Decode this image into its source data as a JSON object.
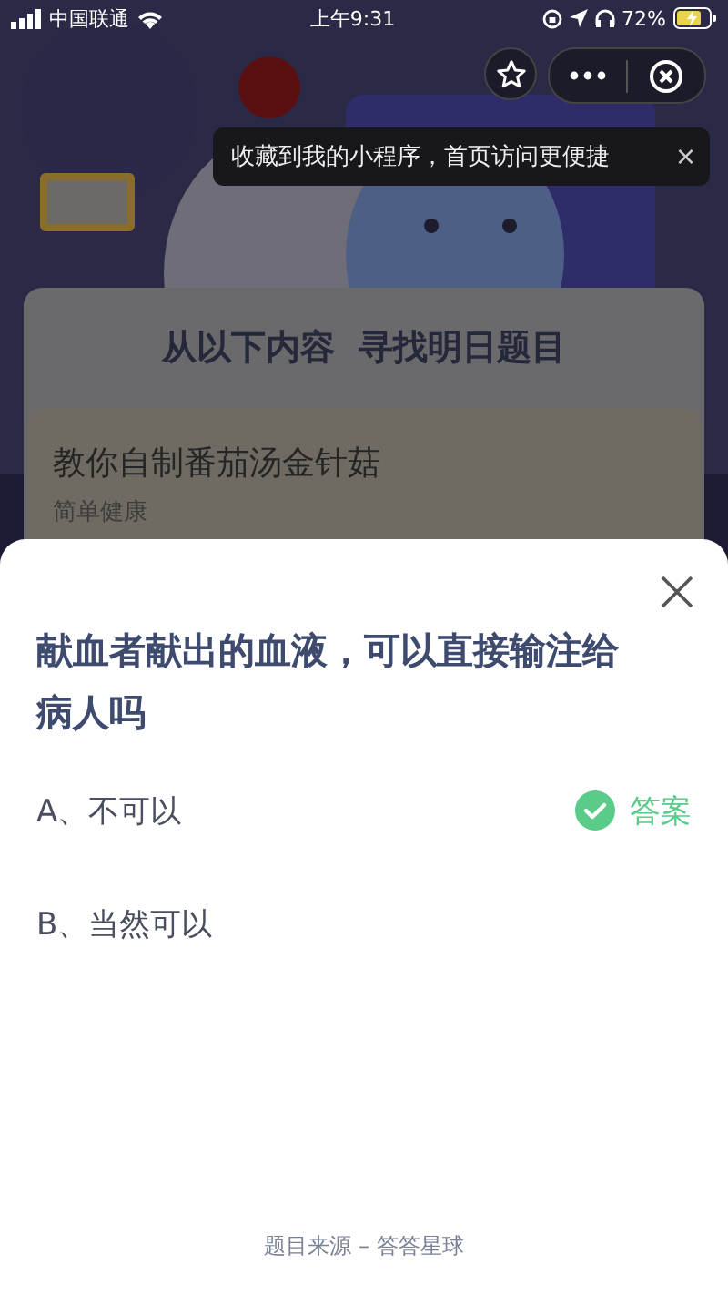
{
  "status_bar": {
    "carrier": "中国联通",
    "time": "上午9:31",
    "battery": "72%"
  },
  "tooltip": {
    "text": "收藏到我的小程序，首页访问更便捷",
    "close": "×"
  },
  "card": {
    "title": "从以下内容  寻找明日题目",
    "article": {
      "title": "教你自制番茄汤金针菇",
      "subtitle": "简单健康"
    }
  },
  "sheet": {
    "question": "献血者献出的血液，可以直接输注给病人吗",
    "options": [
      {
        "label": "A、不可以",
        "correct": true
      },
      {
        "label": "B、当然可以",
        "correct": false
      }
    ],
    "answer_label": "答案",
    "footer": "题目来源 – 答答星球"
  }
}
